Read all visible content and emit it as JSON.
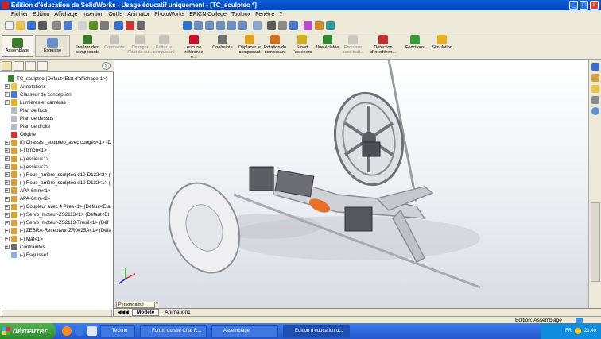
{
  "window": {
    "title": "Edition d'éducation de SolidWorks - Usage éducatif uniquement - [TC_sculpteo *]",
    "min_glyph": "_",
    "max_glyph": "□",
    "close_glyph": "×"
  },
  "menu": [
    "Fichier",
    "Edition",
    "Affichage",
    "Insertion",
    "Outils",
    "Animator",
    "PhotoWorks",
    "EFICN College",
    "Toolbox",
    "Fenêtre",
    "?"
  ],
  "command_manager": {
    "tabs": [
      {
        "label": "Assemblage"
      },
      {
        "label": "Esquisse"
      }
    ],
    "commands": [
      {
        "label": "Insérer des composants",
        "icon": "insert-component-icon",
        "enabled": true
      },
      {
        "label": "Contrainte",
        "icon": "mate-icon",
        "enabled": false
      },
      {
        "label": "Changer l'état de su...",
        "icon": "change-state-icon",
        "enabled": false
      },
      {
        "label": "Editer le composant",
        "icon": "edit-component-icon",
        "enabled": false
      },
      {
        "label": "Aucune référence e...",
        "icon": "no-reference-icon",
        "enabled": true
      },
      {
        "label": "Contrainte",
        "icon": "paperclip-icon",
        "enabled": true
      },
      {
        "label": "Déplacer le composant",
        "icon": "move-component-icon",
        "enabled": true
      },
      {
        "label": "Rotation du composant",
        "icon": "rotate-component-icon",
        "enabled": true
      },
      {
        "label": "Smart Fasteners",
        "icon": "smart-fasteners-icon",
        "enabled": true
      },
      {
        "label": "Vue éclatée",
        "icon": "exploded-view-icon",
        "enabled": true
      },
      {
        "label": "Esquisse avec trait...",
        "icon": "explode-line-icon",
        "enabled": false
      },
      {
        "label": "Détection d'interféren...",
        "icon": "interference-icon",
        "enabled": true
      },
      {
        "label": "Fonctions",
        "icon": "features-icon",
        "enabled": true
      },
      {
        "label": "Simulation",
        "icon": "simulation-icon",
        "enabled": true
      }
    ]
  },
  "tree": [
    {
      "label": "TC_sculpteo  (Défaut<Etat d'affichage-1>)",
      "icon": "assembly-icon",
      "exp": false,
      "root": true
    },
    {
      "label": "Annotations",
      "icon": "annotations-icon",
      "exp": true
    },
    {
      "label": "Classeur de conception",
      "icon": "design-binder-icon",
      "exp": true
    },
    {
      "label": "Lumières et caméras",
      "icon": "lights-icon",
      "exp": true
    },
    {
      "label": "Plan de face",
      "icon": "plane-icon",
      "exp": false
    },
    {
      "label": "Plan de dessus",
      "icon": "plane-icon",
      "exp": false
    },
    {
      "label": "Plan de droite",
      "icon": "plane-icon",
      "exp": false
    },
    {
      "label": "Origine",
      "icon": "origin-icon",
      "exp": false
    },
    {
      "label": "(f) Chassis _sculpteo_avec congés<1> (D",
      "icon": "part-icon",
      "exp": true
    },
    {
      "label": "(-) timon<1>",
      "icon": "part-icon",
      "exp": true
    },
    {
      "label": "(-) essieu<1>",
      "icon": "part-icon",
      "exp": true
    },
    {
      "label": "(-) essieu<2>",
      "icon": "part-icon",
      "exp": true
    },
    {
      "label": "(-) Roue_arrière_sculpteo d10-D132<2> (",
      "icon": "part-icon",
      "exp": true
    },
    {
      "label": "(-) Roue_arrière_sculpteo d10-D132<1> (",
      "icon": "part-icon",
      "exp": true
    },
    {
      "label": "APA-6mm<1>",
      "icon": "part-icon",
      "exp": true
    },
    {
      "label": "APA-6mm<2>",
      "icon": "part-icon",
      "exp": true
    },
    {
      "label": "(-) Coupleur avec 4 Piles<1> (Défaut<Eta",
      "icon": "part-icon",
      "exp": true
    },
    {
      "label": "(-) Servo_moteur-ZS2113<1> (Défaut<Et",
      "icon": "part-icon",
      "exp": true
    },
    {
      "label": "(-) Servo_moteur-ZS2113-Treuil<1> (Déf",
      "icon": "part-icon",
      "exp": true
    },
    {
      "label": "(-) ZEBRA-Recepteur-ZR0025A<1> (Défa",
      "icon": "part-icon",
      "exp": true
    },
    {
      "label": "(-) Mât<1>",
      "icon": "part-icon",
      "exp": true
    },
    {
      "label": "Contraintes",
      "icon": "mates-icon",
      "exp": true
    },
    {
      "label": "(-) Esquisse1",
      "icon": "sketch-icon",
      "exp": false
    }
  ],
  "viewport": {
    "config_box": "Personnalisé"
  },
  "bottom_tabs": [
    "Modèle",
    "Animation1"
  ],
  "status": {
    "right": "Edition: Assemblage"
  },
  "taskbar": {
    "start": "démarrer",
    "items": [
      {
        "label": "Techno",
        "active": false
      },
      {
        "label": "Forum du site Char R...",
        "active": false
      },
      {
        "label": "Assemblage",
        "active": false
      },
      {
        "label": "Edition d'éducation d...",
        "active": true
      }
    ],
    "lang": "FR",
    "clock": "21:40"
  },
  "colors": {
    "accent": "#0a5fd8",
    "sw_red": "#c8102e",
    "motor_orange": "#e8702a"
  }
}
